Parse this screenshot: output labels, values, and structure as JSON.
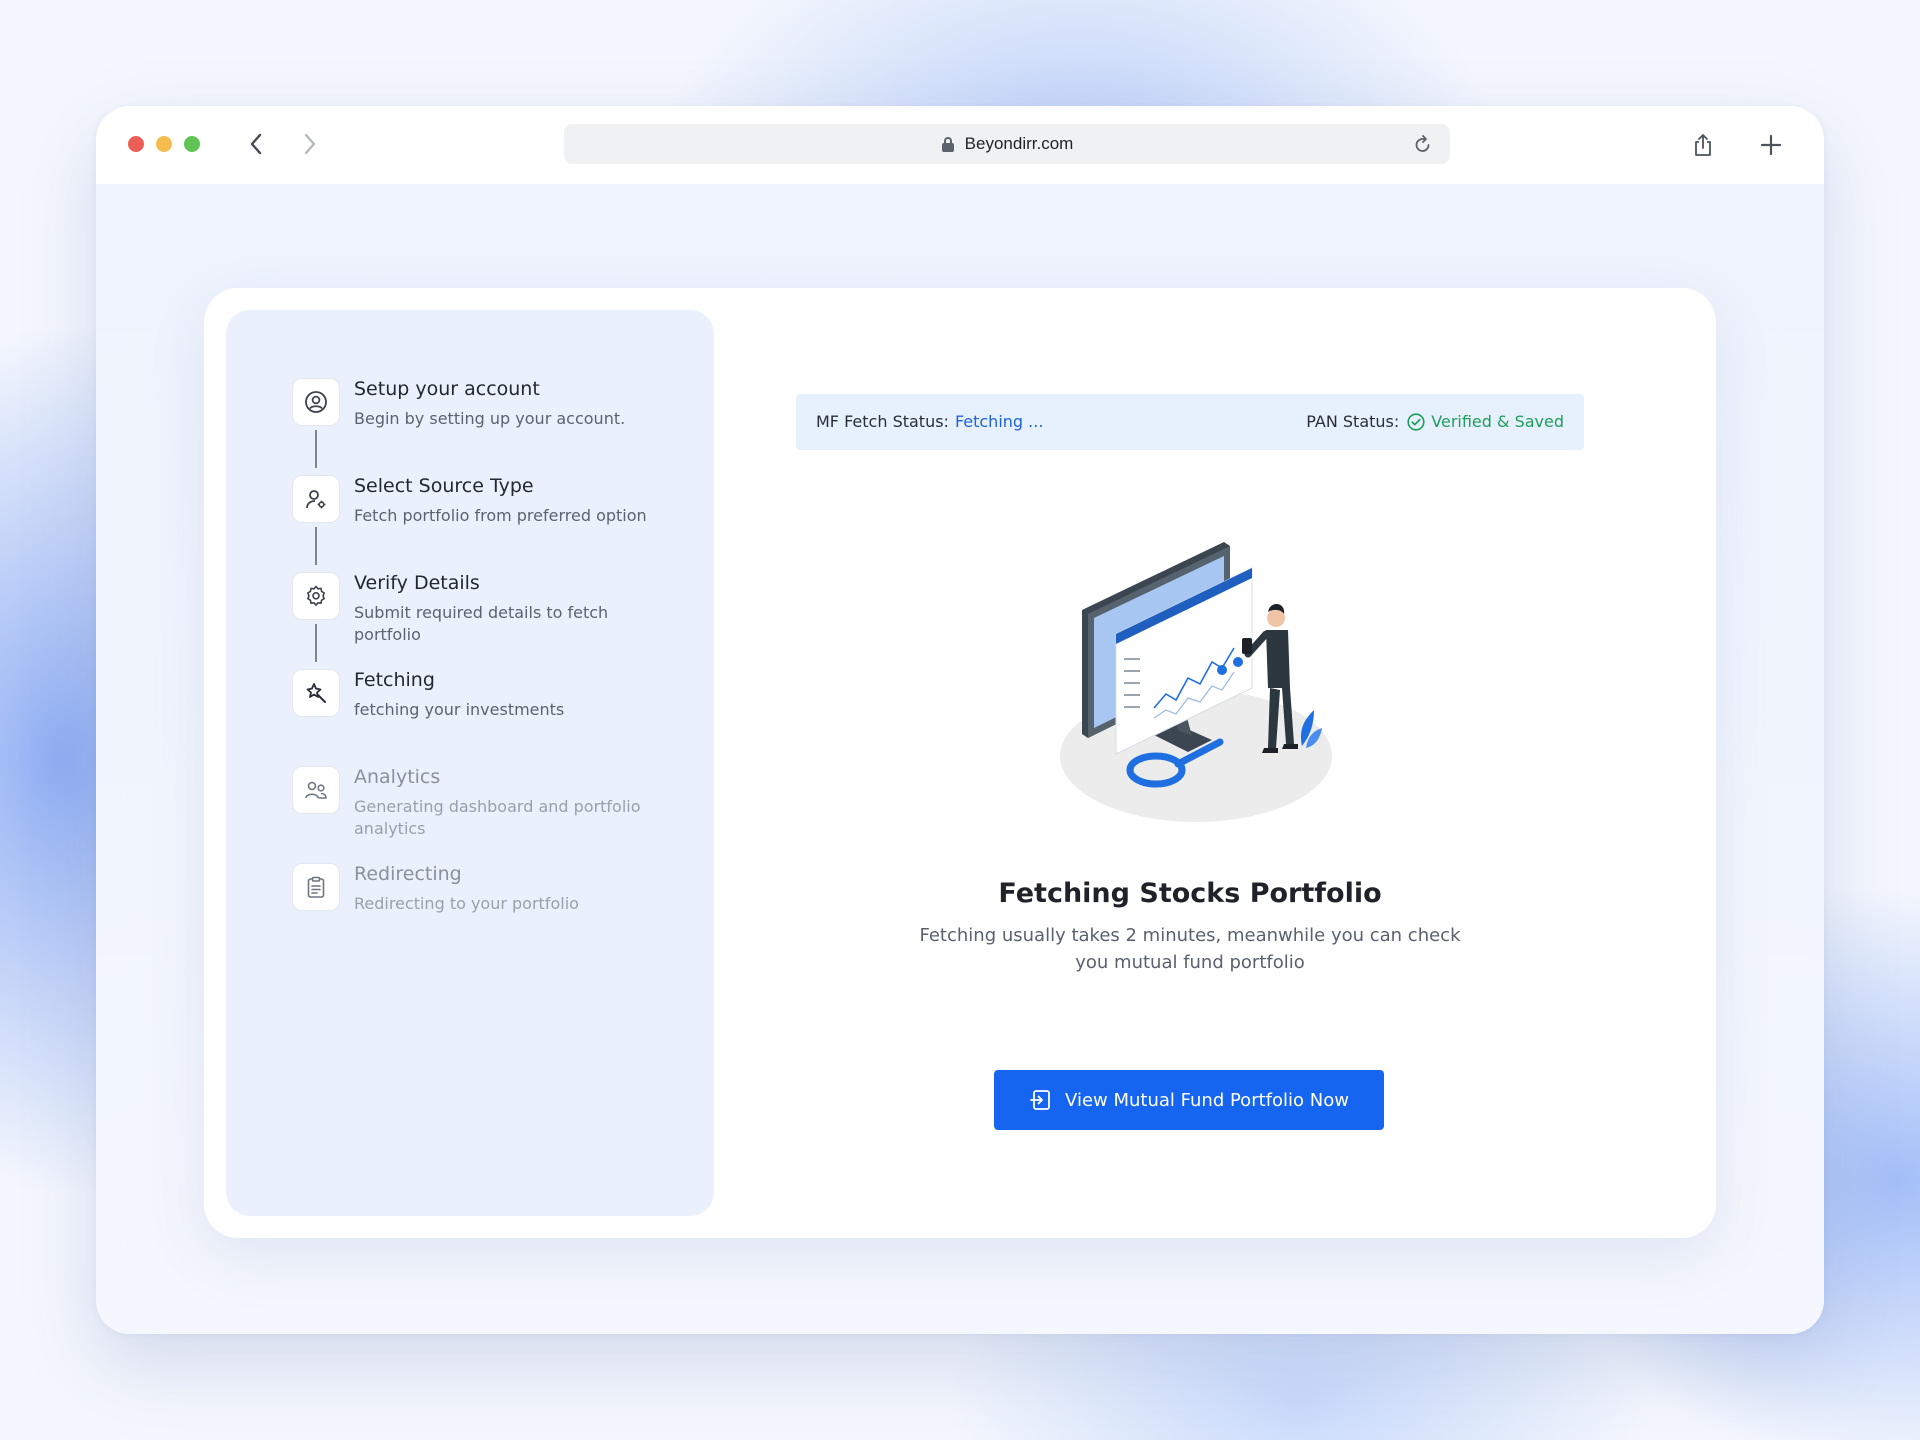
{
  "browser": {
    "url": "Beyondirr.com"
  },
  "status": {
    "mf_label": "MF Fetch Status:",
    "mf_value": "Fetching ...",
    "pan_label": "PAN Status:",
    "pan_value": "Verified & Saved"
  },
  "steps": [
    {
      "title": "Setup your account",
      "desc": "Begin by setting up your account.",
      "icon": "user-circle-icon",
      "state": "done"
    },
    {
      "title": "Select Source Type",
      "desc": "Fetch portfolio from preferred option",
      "icon": "user-settings-icon",
      "state": "done"
    },
    {
      "title": "Verify Details",
      "desc": "Submit required details to fetch portfolio",
      "icon": "gear-icon",
      "state": "done"
    },
    {
      "title": "Fetching",
      "desc": "fetching your investments",
      "icon": "magic-wand-icon",
      "state": "active"
    },
    {
      "title": "Analytics",
      "desc": "Generating dashboard and portfolio analytics",
      "icon": "users-icon",
      "state": "pending"
    },
    {
      "title": "Redirecting",
      "desc": "Redirecting to your portfolio",
      "icon": "clipboard-icon",
      "state": "pending"
    }
  ],
  "main": {
    "headline": "Fetching Stocks Portfolio",
    "subtext": "Fetching usually takes 2 minutes, meanwhile you can check you mutual fund portfolio",
    "cta_label": "View Mutual Fund Portfolio Now"
  },
  "colors": {
    "accent": "#1565f0",
    "status_fetching": "#1f63d6",
    "status_verified": "#1e9e5a",
    "sidebar_bg": "#eaf1fd"
  }
}
